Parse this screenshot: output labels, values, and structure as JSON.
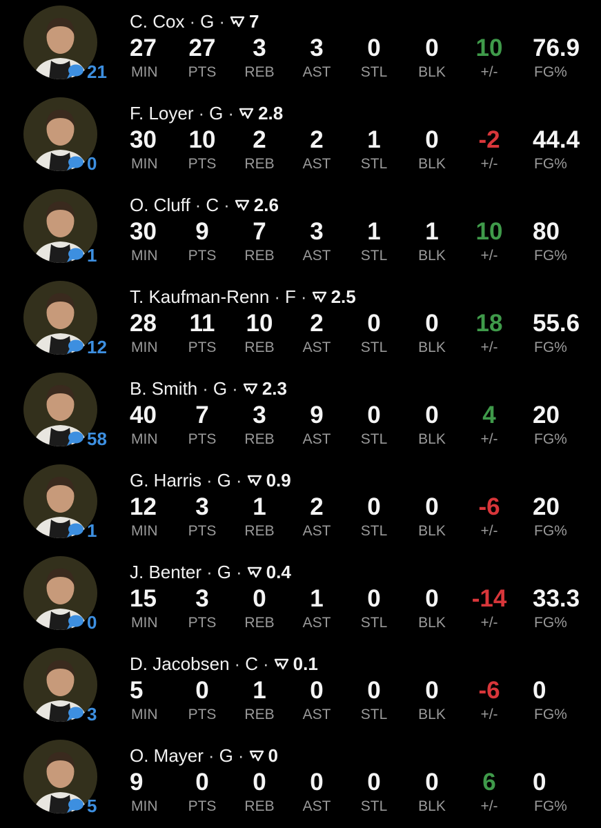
{
  "colors": {
    "background": "#000000",
    "positive": "#3f9a4a",
    "negative": "#d8363a",
    "comment_accent": "#3d8fe0",
    "label_gray": "#9a9a9a"
  },
  "icons": {
    "comment": "speech-bubble-icon",
    "fantasy": "fantasy-score-icon"
  },
  "separator": "·",
  "labels": {
    "min": "MIN",
    "pts": "PTS",
    "reb": "REB",
    "ast": "AST",
    "stl": "STL",
    "blk": "BLK",
    "pm": "+/-",
    "fg": "FG%"
  },
  "players": [
    {
      "name": "C. Cox",
      "pos": "G",
      "rating": "7",
      "comments": "21",
      "min": "27",
      "pts": "27",
      "reb": "3",
      "ast": "3",
      "stl": "0",
      "blk": "0",
      "pm": "10",
      "fg": "76.9"
    },
    {
      "name": "F. Loyer",
      "pos": "G",
      "rating": "2.8",
      "comments": "0",
      "min": "30",
      "pts": "10",
      "reb": "2",
      "ast": "2",
      "stl": "1",
      "blk": "0",
      "pm": "-2",
      "fg": "44.4"
    },
    {
      "name": "O. Cluff",
      "pos": "C",
      "rating": "2.6",
      "comments": "1",
      "min": "30",
      "pts": "9",
      "reb": "7",
      "ast": "3",
      "stl": "1",
      "blk": "1",
      "pm": "10",
      "fg": "80"
    },
    {
      "name": "T. Kaufman-Renn",
      "pos": "F",
      "rating": "2.5",
      "comments": "12",
      "min": "28",
      "pts": "11",
      "reb": "10",
      "ast": "2",
      "stl": "0",
      "blk": "0",
      "pm": "18",
      "fg": "55.6"
    },
    {
      "name": "B. Smith",
      "pos": "G",
      "rating": "2.3",
      "comments": "58",
      "min": "40",
      "pts": "7",
      "reb": "3",
      "ast": "9",
      "stl": "0",
      "blk": "0",
      "pm": "4",
      "fg": "20"
    },
    {
      "name": "G. Harris",
      "pos": "G",
      "rating": "0.9",
      "comments": "1",
      "min": "12",
      "pts": "3",
      "reb": "1",
      "ast": "2",
      "stl": "0",
      "blk": "0",
      "pm": "-6",
      "fg": "20"
    },
    {
      "name": "J. Benter",
      "pos": "G",
      "rating": "0.4",
      "comments": "0",
      "min": "15",
      "pts": "3",
      "reb": "0",
      "ast": "1",
      "stl": "0",
      "blk": "0",
      "pm": "-14",
      "fg": "33.3"
    },
    {
      "name": "D. Jacobsen",
      "pos": "C",
      "rating": "0.1",
      "comments": "3",
      "min": "5",
      "pts": "0",
      "reb": "1",
      "ast": "0",
      "stl": "0",
      "blk": "0",
      "pm": "-6",
      "fg": "0"
    },
    {
      "name": "O. Mayer",
      "pos": "G",
      "rating": "0",
      "comments": "5",
      "min": "9",
      "pts": "0",
      "reb": "0",
      "ast": "0",
      "stl": "0",
      "blk": "0",
      "pm": "6",
      "fg": "0"
    }
  ]
}
